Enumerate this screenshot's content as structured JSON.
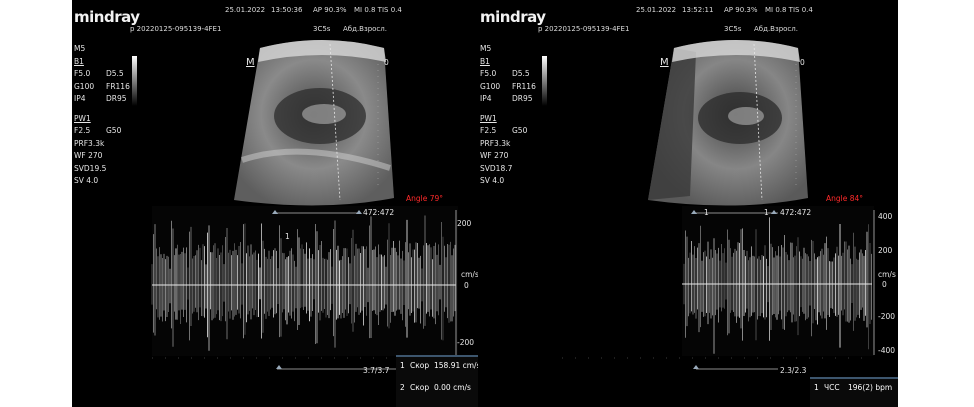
{
  "left": {
    "logo": "mindray",
    "patient_id": "p 20220125-095139-4FE1",
    "date": "25.01.2022",
    "time": "13:50:36",
    "ap": "AP 90.3%",
    "mi_tis": "MI 0.8 TIS 0.4",
    "probe": "3C5s",
    "preset": "Абд.Взросл.",
    "m_marker": "M",
    "depth_zero": "0",
    "params": [
      {
        "a": "M5",
        "b": ""
      },
      {
        "a": "B1",
        "b": ""
      },
      {
        "a": "F5.0",
        "b": "D5.5"
      },
      {
        "a": "G100",
        "b": "FR116"
      },
      {
        "a": "IP4",
        "b": "DR95"
      },
      {
        "a": "",
        "b": ""
      },
      {
        "a": "PW1",
        "b": ""
      },
      {
        "a": "F2.5",
        "b": "G50"
      },
      {
        "a": "PRF3.3k",
        "b": ""
      },
      {
        "a": "WF 270",
        "b": ""
      },
      {
        "a": "SVD19.5",
        "b": ""
      },
      {
        "a": "SV 4.0",
        "b": ""
      }
    ],
    "angle": "Angle 79°",
    "scale_top": "472:472",
    "scale_bottom": "3.7/3.7",
    "gate_label": "1",
    "vel_labels": [
      "200",
      "cm/s",
      "0",
      "-200"
    ],
    "measurements": [
      {
        "num": "1",
        "name": "Скор",
        "value": "158.91 cm/s"
      },
      {
        "num": "2",
        "name": "Скор",
        "value": "0.00 cm/s"
      }
    ]
  },
  "right": {
    "logo": "mindray",
    "patient_id": "p 20220125-095139-4FE1",
    "date": "25.01.2022",
    "time": "13:52:11",
    "ap": "AP 90.3%",
    "mi_tis": "MI 0.8 TIS 0.4",
    "probe": "3C5s",
    "preset": "Абд.Взросл.",
    "m_marker": "M",
    "depth_zero": "0",
    "params": [
      {
        "a": "M5",
        "b": ""
      },
      {
        "a": "B1",
        "b": ""
      },
      {
        "a": "F5.0",
        "b": "D5.5"
      },
      {
        "a": "G100",
        "b": "FR116"
      },
      {
        "a": "IP4",
        "b": "DR95"
      },
      {
        "a": "",
        "b": ""
      },
      {
        "a": "PW1",
        "b": ""
      },
      {
        "a": "F2.5",
        "b": "G50"
      },
      {
        "a": "PRF3.3k",
        "b": ""
      },
      {
        "a": "WF 270",
        "b": ""
      },
      {
        "a": "SVD18.7",
        "b": ""
      },
      {
        "a": "SV 4.0",
        "b": ""
      }
    ],
    "angle": "Angle 84°",
    "scale_top": "472:472",
    "scale_bottom": "2.3/2.3",
    "gate_label": "1",
    "gate_label2": "1",
    "vel_labels": [
      "400",
      "200",
      "cm/s",
      "0",
      "-200",
      "-400"
    ],
    "measurements": [
      {
        "num": "1",
        "name": "ЧСС",
        "value": "196(2) bpm"
      }
    ]
  }
}
